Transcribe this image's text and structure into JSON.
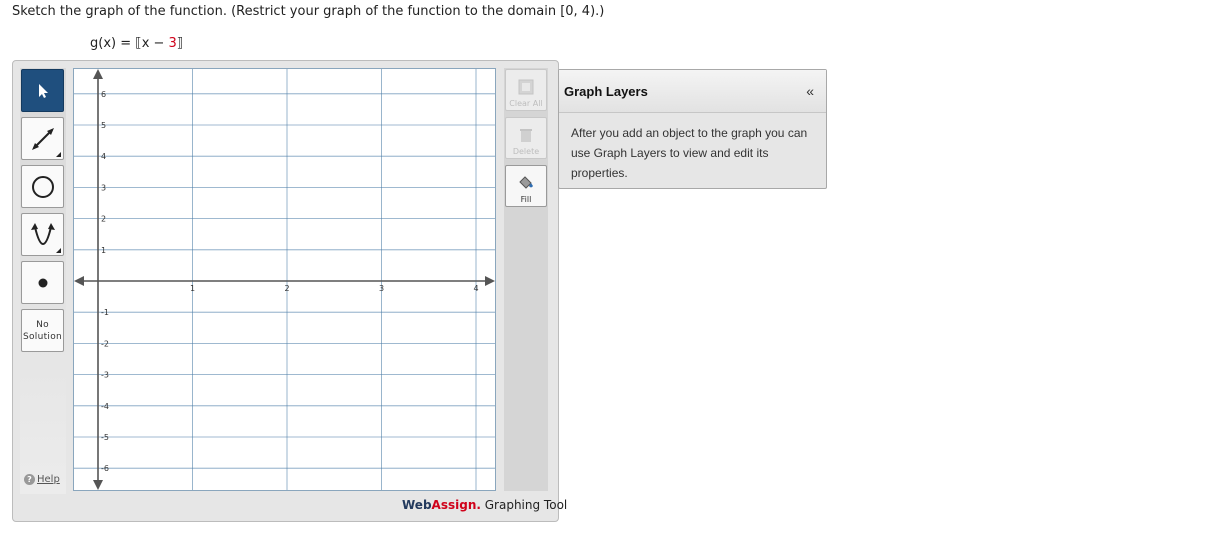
{
  "prompt": "Sketch the graph of the function. (Restrict your graph of the function to the domain [0, 4).)",
  "function": {
    "lhs": "g(x) = ",
    "open": "⟦",
    "body": "x − ",
    "const": "3",
    "close": "⟧"
  },
  "toolbar": {
    "no_solution_line1": "No",
    "no_solution_line2": "Solution",
    "help": "Help"
  },
  "graph": {
    "x_ticks": [
      "1",
      "2",
      "3",
      "4"
    ],
    "y_ticks": [
      "6",
      "5",
      "4",
      "3",
      "2",
      "1",
      "-1",
      "-2",
      "-3",
      "-4",
      "-5",
      "-6"
    ],
    "grid_color": "#4a7ca6",
    "axis_color": "#555555"
  },
  "side_buttons": {
    "clear_all": "Clear All",
    "delete": "Delete",
    "fill": "Fill"
  },
  "brand": {
    "web": "Web",
    "assign": "Assign.",
    "rest": " Graphing Tool"
  },
  "layers": {
    "title": "Graph Layers",
    "collapse": "«",
    "body": "After you add an object to the graph you can use Graph Layers to view and edit its properties."
  }
}
